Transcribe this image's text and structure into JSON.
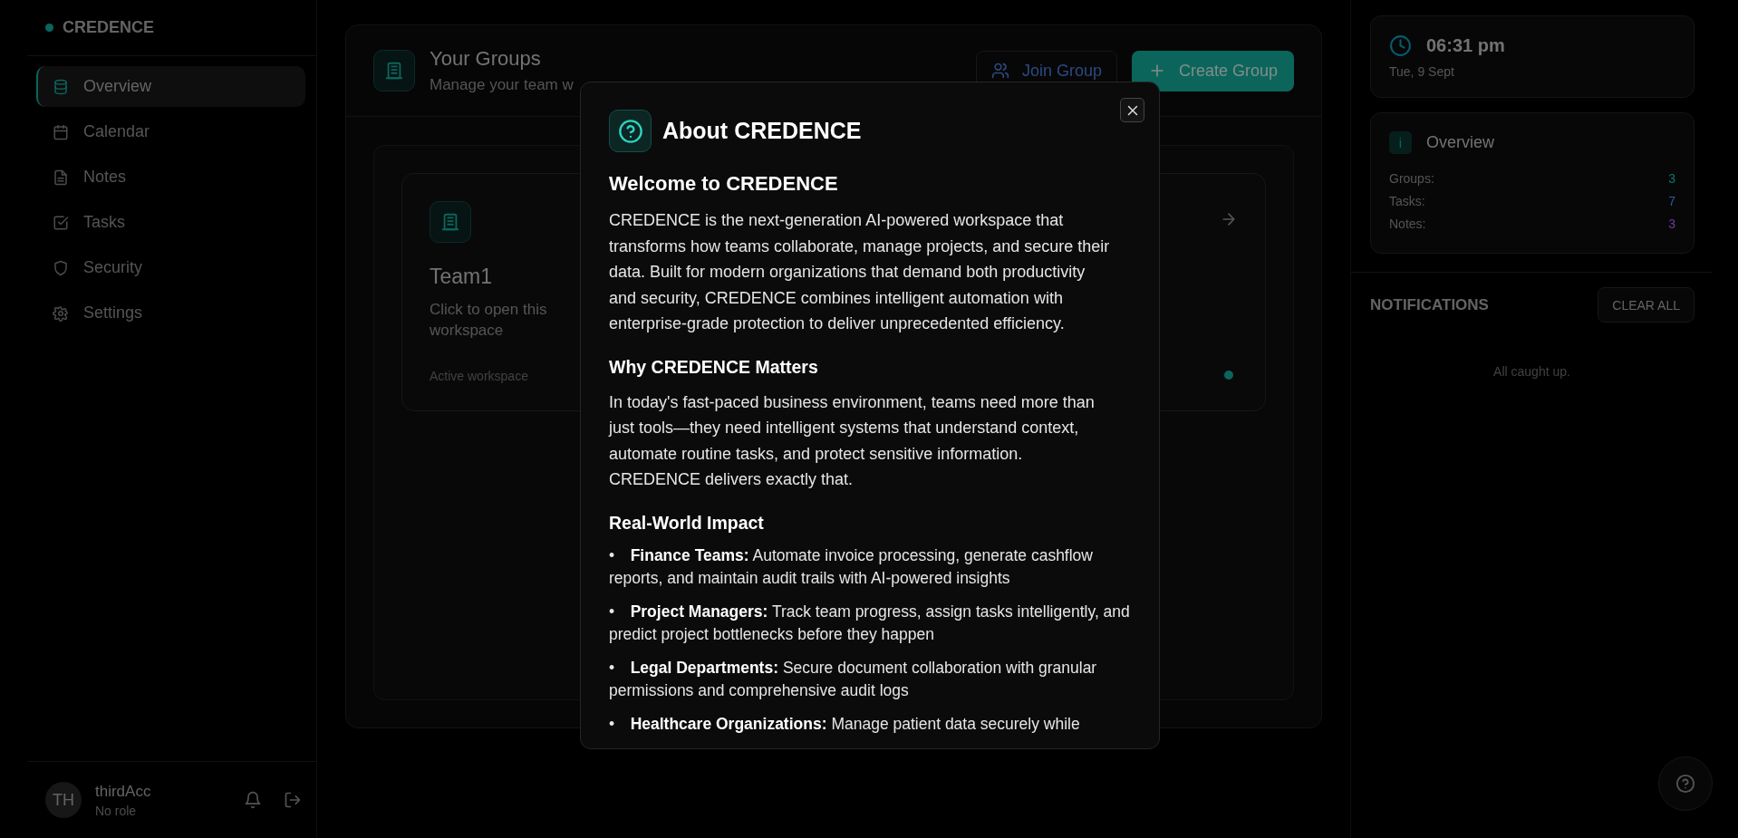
{
  "sidebar": {
    "brand": "CREDENCE",
    "items": [
      {
        "label": "Overview",
        "selected": true
      },
      {
        "label": "Calendar",
        "selected": false
      },
      {
        "label": "Notes",
        "selected": false
      },
      {
        "label": "Tasks",
        "selected": false
      },
      {
        "label": "Security",
        "selected": false
      },
      {
        "label": "Settings",
        "selected": false
      }
    ],
    "user": {
      "initials": "TH",
      "name": "thirdAcc",
      "role": "No role"
    }
  },
  "main": {
    "header": {
      "title": "Your Groups",
      "subtitle": "Manage your team w",
      "buttons": [
        {
          "label": "Join Group",
          "kind": "outline"
        },
        {
          "label": "Create Group",
          "kind": "primary"
        }
      ]
    },
    "groups": [
      {
        "name": "Team1",
        "description": "Click to open this workspace",
        "status": "Active workspace",
        "active": true
      }
    ]
  },
  "right_panel": {
    "clock": {
      "time": "06:31 pm",
      "date": "Tue, 9 Sept"
    },
    "overview": {
      "badge": "i",
      "title": "Overview",
      "stats": [
        {
          "label": "Groups:",
          "value": "3",
          "color": "#0f766e"
        },
        {
          "label": "Tasks:",
          "value": "7",
          "color": "#2b5ea8"
        },
        {
          "label": "Notes:",
          "value": "3",
          "color": "#6d3aa0"
        }
      ]
    },
    "notifications": {
      "title": "NOTIFICATIONS",
      "clear_button": "CLEAR ALL",
      "empty_message": "All caught up."
    }
  },
  "modal": {
    "title": "About CREDENCE",
    "sections": [
      {
        "kind": "heading",
        "text": "Welcome to CREDENCE"
      },
      {
        "kind": "paragraph",
        "text": "CREDENCE is the next-generation AI-powered workspace that transforms how teams collaborate, manage projects, and secure their data. Built for modern organizations that demand both productivity and security, CREDENCE combines intelligent automation with enterprise-grade protection to deliver unprecedented efficiency."
      },
      {
        "kind": "subheading",
        "text": "Why CREDENCE Matters"
      },
      {
        "kind": "paragraph",
        "text": "In today's fast-paced business environment, teams need more than just tools—they need intelligent systems that understand context, automate routine tasks, and protect sensitive information. CREDENCE delivers exactly that."
      },
      {
        "kind": "subheading",
        "text": "Real-World Impact"
      },
      {
        "kind": "list",
        "items": [
          "• **Finance Teams:** Automate invoice processing, generate cashflow reports, and maintain audit trails with AI-powered insights",
          "• **Project Managers:** Track team progress, assign tasks intelligently, and predict project bottlenecks before they happen",
          "• **Legal Departments:** Secure document collaboration with granular permissions and comprehensive audit logs",
          "• **Healthcare Organizations:** Manage patient data securely while"
        ]
      }
    ]
  }
}
